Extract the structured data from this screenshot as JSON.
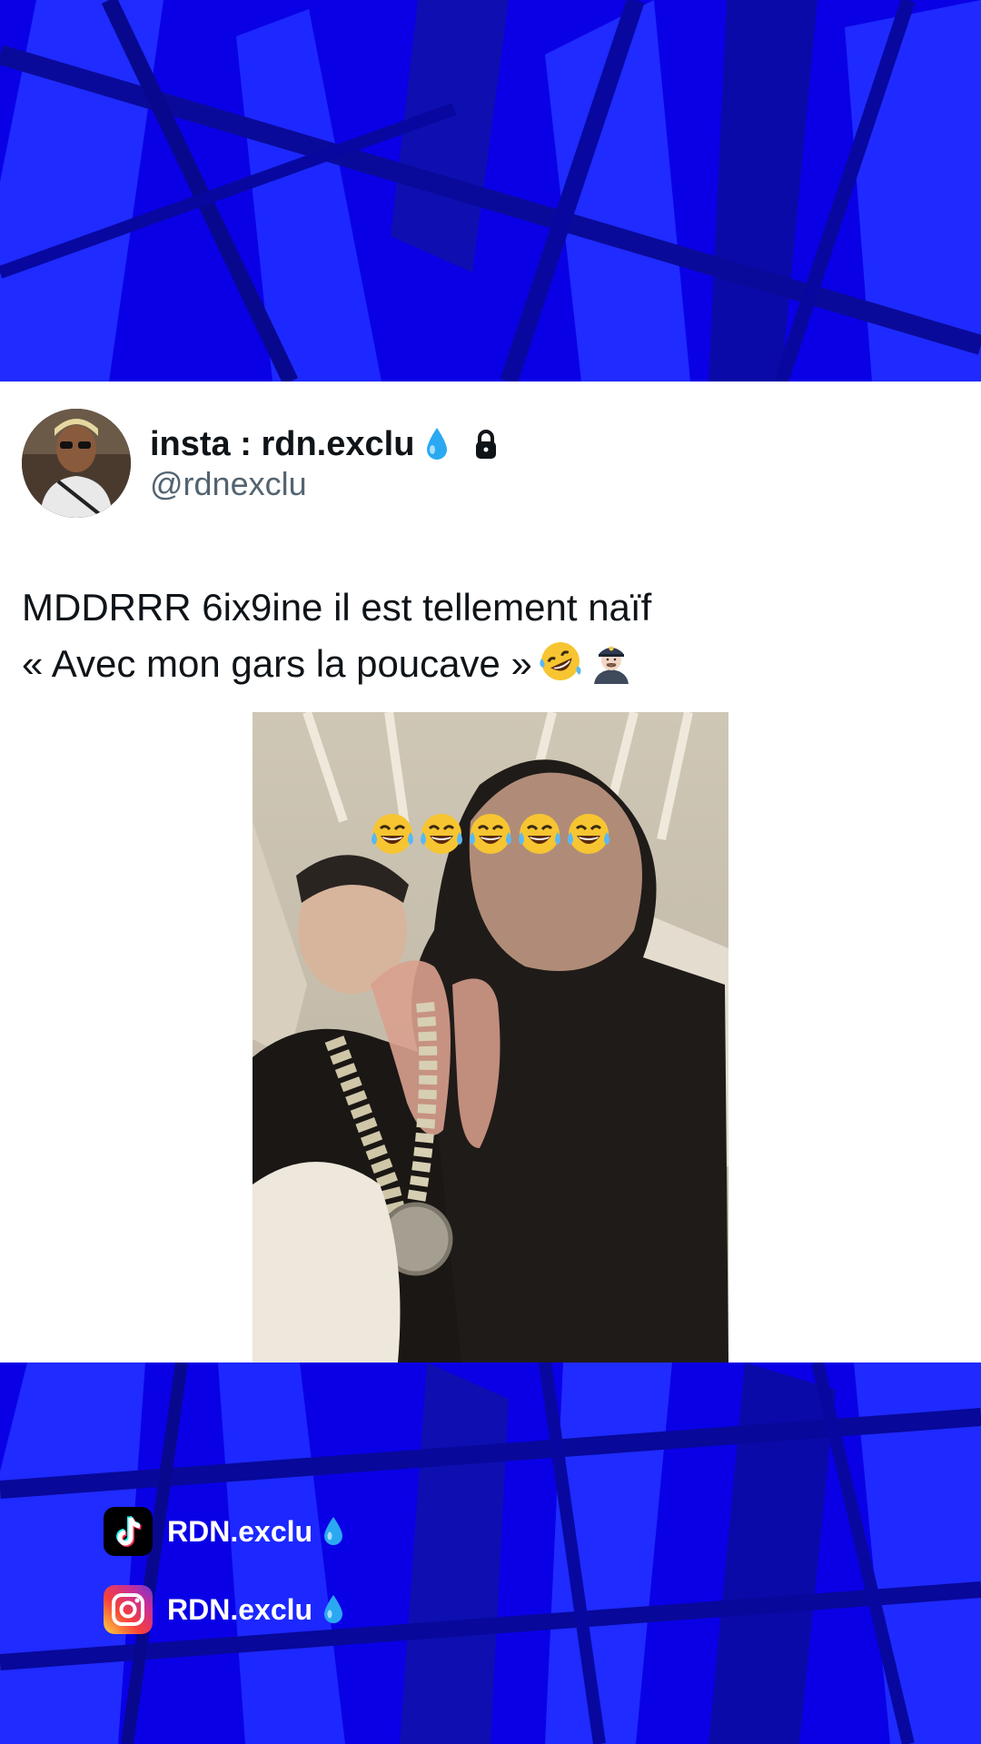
{
  "colors": {
    "background": "#0a00e0",
    "card": "#ffffff",
    "text_primary": "#0f1419",
    "text_secondary": "#536471",
    "water_drop": "#2aa9f2"
  },
  "tweet": {
    "display_name": "insta : rdn.exclu",
    "handle": "@rdnexclu",
    "name_badges": [
      "water-drop-icon",
      "lock-icon"
    ],
    "text_line_1": "MDDRRR 6ix9ine il est tellement naïf",
    "text_line_2": "« Avec mon gars la poucave »",
    "text_emojis": [
      "rolling-laughing-emoji",
      "police-officer-emoji"
    ],
    "media": {
      "overlay_emojis": [
        "laughing-tears-emoji",
        "laughing-tears-emoji",
        "laughing-tears-emoji",
        "laughing-tears-emoji",
        "laughing-tears-emoji"
      ]
    }
  },
  "socials": [
    {
      "platform_icon": "tiktok-icon",
      "label": "RDN.exclu"
    },
    {
      "platform_icon": "instagram-icon",
      "label": "RDN.exclu"
    }
  ]
}
